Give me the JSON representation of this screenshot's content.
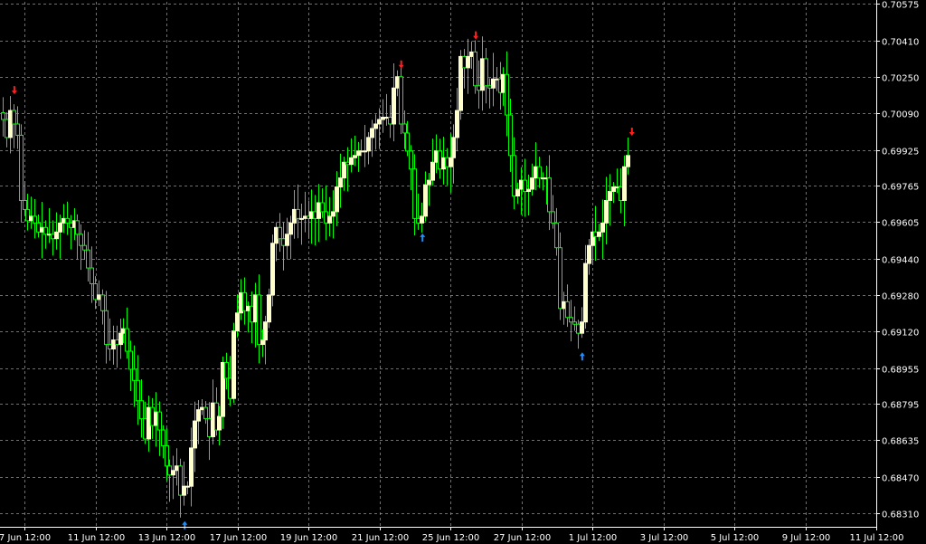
{
  "chart_data": {
    "type": "candlestick",
    "background": "#000000",
    "grid": true,
    "colors": {
      "bull_body": "#ffffcc",
      "bear_body": "#00ff00",
      "wick": "#00ff00",
      "grid": "#a0a0a0",
      "axis": "#ffffff",
      "text": "#ffffff",
      "arrow_up": "#1e90ff",
      "arrow_down": "#ff2020"
    },
    "y_ticks": [
      "0.70575",
      "0.70410",
      "0.70250",
      "0.70090",
      "0.69925",
      "0.69765",
      "0.69605",
      "0.69440",
      "0.69280",
      "0.69120",
      "0.68955",
      "0.68795",
      "0.68635",
      "0.68470",
      "0.68310"
    ],
    "ylim": [
      0.6824,
      0.7058
    ],
    "x_ticks": [
      "7 Jun 12:00",
      "11 Jun 12:00",
      "13 Jun 12:00",
      "17 Jun 12:00",
      "19 Jun 12:00",
      "21 Jun 12:00",
      "25 Jun 12:00",
      "27 Jun 12:00",
      "1 Jul 12:00",
      "3 Jul 12:00",
      "5 Jul 12:00",
      "9 Jul 12:00",
      "11 Jul 12:00"
    ],
    "bars_per_x_tick": 20,
    "close": [
      0.7006,
      0.6998,
      0.701,
      0.7004,
      0.6999,
      0.697,
      0.6966,
      0.6961,
      0.6963,
      0.696,
      0.6956,
      0.6958,
      0.6955,
      0.6955,
      0.6953,
      0.6956,
      0.696,
      0.6962,
      0.696,
      0.6958,
      0.6961,
      0.6955,
      0.695,
      0.6948,
      0.694,
      0.6933,
      0.6926,
      0.6928,
      0.6921,
      0.6906,
      0.6904,
      0.6908,
      0.6906,
      0.6911,
      0.6913,
      0.6903,
      0.6895,
      0.689,
      0.6881,
      0.6873,
      0.6864,
      0.6878,
      0.687,
      0.6876,
      0.6868,
      0.6861,
      0.6852,
      0.6848,
      0.685,
      0.6852,
      0.6839,
      0.6843,
      0.6843,
      0.686,
      0.6872,
      0.6877,
      0.6878,
      0.6873,
      0.6865,
      0.688,
      0.6868,
      0.6874,
      0.6898,
      0.6891,
      0.6882,
      0.6912,
      0.692,
      0.6929,
      0.6921,
      0.6923,
      0.6916,
      0.6928,
      0.6906,
      0.6908,
      0.6916,
      0.6928,
      0.6951,
      0.6958,
      0.6953,
      0.695,
      0.6955,
      0.696,
      0.6966,
      0.6962,
      0.6962,
      0.6963,
      0.6962,
      0.6965,
      0.6962,
      0.6969,
      0.6965,
      0.696,
      0.6963,
      0.6965,
      0.6976,
      0.698,
      0.6987,
      0.6986,
      0.6989,
      0.699,
      0.6992,
      0.6992,
      0.6992,
      0.6998,
      0.7002,
      0.7004,
      0.7006,
      0.7007,
      0.7007,
      0.7004,
      0.702,
      0.7025,
      0.7004,
      0.7,
      0.6992,
      0.6984,
      0.6962,
      0.696,
      0.6963,
      0.6977,
      0.6979,
      0.6987,
      0.6992,
      0.6984,
      0.6989,
      0.6985,
      0.6989,
      0.6998,
      0.701,
      0.7034,
      0.7029,
      0.7034,
      0.7036,
      0.7021,
      0.7019,
      0.7033,
      0.7021,
      0.702,
      0.7024,
      0.7024,
      0.7018,
      0.7026,
      0.7008,
      0.699,
      0.6972,
      0.6975,
      0.6979,
      0.6974,
      0.6975,
      0.698,
      0.6985,
      0.698,
      0.698,
      0.698,
      0.6965,
      0.696,
      0.6949,
      0.6922,
      0.6925,
      0.6918,
      0.6916,
      0.6915,
      0.6911,
      0.6916,
      0.6942,
      0.695,
      0.6956,
      0.6954,
      0.6956,
      0.696,
      0.697,
      0.6974,
      0.6976,
      0.6976,
      0.697,
      0.6985,
      0.699
    ]
  }
}
